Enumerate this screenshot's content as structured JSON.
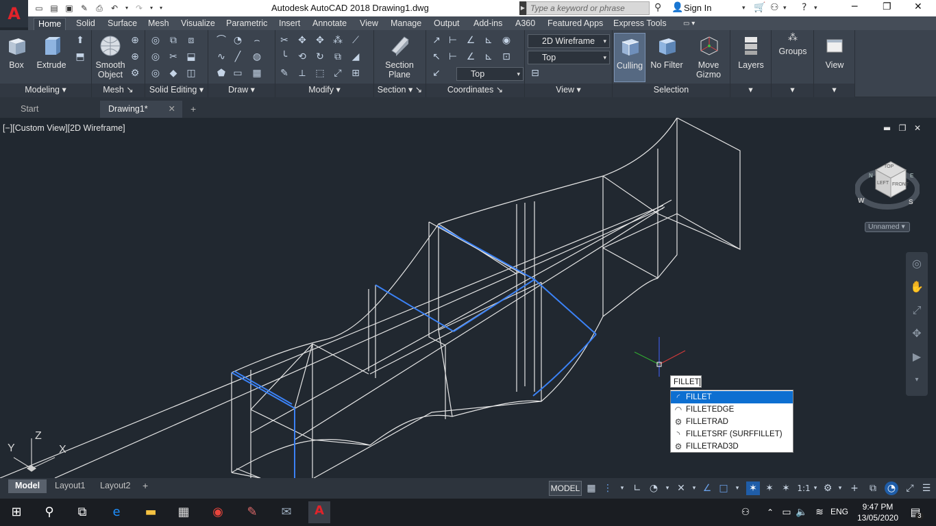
{
  "titlebar": {
    "title": "Autodesk AutoCAD 2018    Drawing1.dwg",
    "search_placeholder": "Type a keyword or phrase",
    "signin_label": "Sign In"
  },
  "ribbon_tabs": [
    "Home",
    "Solid",
    "Surface",
    "Mesh",
    "Visualize",
    "Parametric",
    "Insert",
    "Annotate",
    "View",
    "Manage",
    "Output",
    "Add-ins",
    "A360",
    "Featured Apps",
    "Express Tools"
  ],
  "panels": {
    "modeling": {
      "title": "Modeling",
      "box": "Box",
      "extrude": "Extrude"
    },
    "mesh": {
      "title": "Mesh",
      "smooth": "Smooth Object"
    },
    "solid_editing": {
      "title": "Solid Editing"
    },
    "draw": {
      "title": "Draw"
    },
    "modify": {
      "title": "Modify"
    },
    "section": {
      "title": "Section",
      "plane": "Section Plane"
    },
    "coordinates": {
      "title": "Coordinates"
    },
    "view": {
      "title": "View",
      "visual_style": "2D Wireframe",
      "view_name": "Top",
      "ucs_name": "Top"
    },
    "selection": {
      "title": "Selection",
      "culling": "Culling",
      "nofilter": "No Filter",
      "gizmo": "Move Gizmo"
    },
    "layers": {
      "label": "Layers"
    },
    "groups": {
      "label": "Groups"
    },
    "viewpanel": {
      "label": "View"
    }
  },
  "doc_tabs": [
    "Start",
    "Drawing1*"
  ],
  "viewport": {
    "label": "[−][Custom View][2D Wireframe]",
    "unnamed": "Unnamed",
    "compass": {
      "w": "W",
      "s": "S",
      "n": "N",
      "e": "E"
    },
    "cube": {
      "top": "TOP",
      "left": "LEFT",
      "front": "FRONT"
    },
    "axes": {
      "x": "X",
      "y": "Y",
      "z": "Z"
    }
  },
  "command": {
    "input": "FILLET",
    "suggestions": [
      "FILLET",
      "FILLETEDGE",
      "FILLETRAD",
      "FILLETSRF (SURFFILLET)",
      "FILLETRAD3D"
    ],
    "selected_index": 0
  },
  "layout_tabs": [
    "Model",
    "Layout1",
    "Layout2"
  ],
  "status": {
    "model": "MODEL",
    "scale": "1:1"
  },
  "taskbar": {
    "lang": "ENG",
    "time": "9:47 PM",
    "date": "13/05/2020",
    "notifications": "3"
  },
  "colors": {
    "accent": "#0d6fd1",
    "viewport_bg": "#212830",
    "highlight_edge": "#3b82f6"
  }
}
